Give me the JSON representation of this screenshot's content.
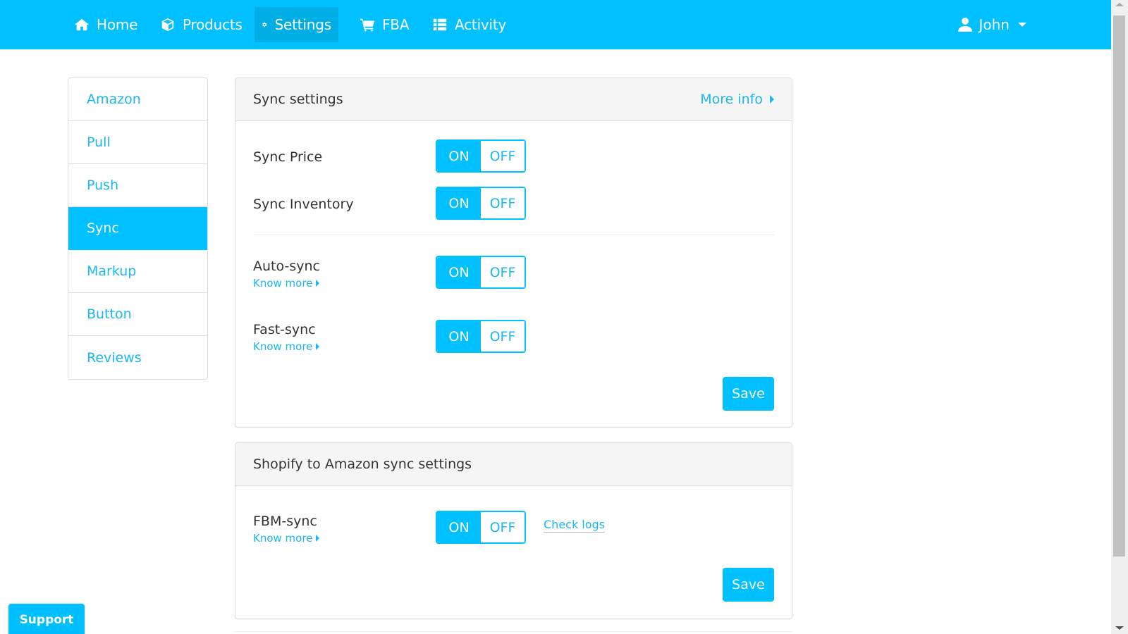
{
  "navbar": {
    "items": [
      {
        "label": "Home",
        "icon": "home-icon"
      },
      {
        "label": "Products",
        "icon": "cube-icon"
      },
      {
        "label": "Settings",
        "icon": "gear-icon",
        "active": true
      },
      {
        "label": "FBA",
        "icon": "cart-icon"
      },
      {
        "label": "Activity",
        "icon": "list-icon"
      }
    ],
    "user": {
      "name": "John",
      "icon": "user-icon"
    }
  },
  "sidebar": {
    "items": [
      {
        "label": "Amazon"
      },
      {
        "label": "Pull"
      },
      {
        "label": "Push"
      },
      {
        "label": "Sync",
        "active": true
      },
      {
        "label": "Markup"
      },
      {
        "label": "Button"
      },
      {
        "label": "Reviews"
      }
    ]
  },
  "sync_settings": {
    "title": "Sync settings",
    "more_info": "More info",
    "rows": [
      {
        "label": "Sync Price",
        "on": "ON",
        "off": "OFF",
        "value": "ON"
      },
      {
        "label": "Sync Inventory",
        "on": "ON",
        "off": "OFF",
        "value": "ON"
      },
      {
        "label": "Auto-sync",
        "know_more": "Know more",
        "on": "ON",
        "off": "OFF",
        "value": "ON"
      },
      {
        "label": "Fast-sync",
        "know_more": "Know more",
        "on": "ON",
        "off": "OFF",
        "value": "ON"
      }
    ],
    "save": "Save"
  },
  "shopify_settings": {
    "title": "Shopify to Amazon sync settings",
    "rows": [
      {
        "label": "FBM-sync",
        "know_more": "Know more",
        "on": "ON",
        "off": "OFF",
        "value": "ON",
        "check_logs": "Check logs"
      }
    ],
    "save": "Save"
  },
  "support": {
    "label": "Support"
  },
  "colors": {
    "accent": "#00c0ff",
    "active_nav": "#00aee6",
    "link": "#1ab7f0"
  }
}
